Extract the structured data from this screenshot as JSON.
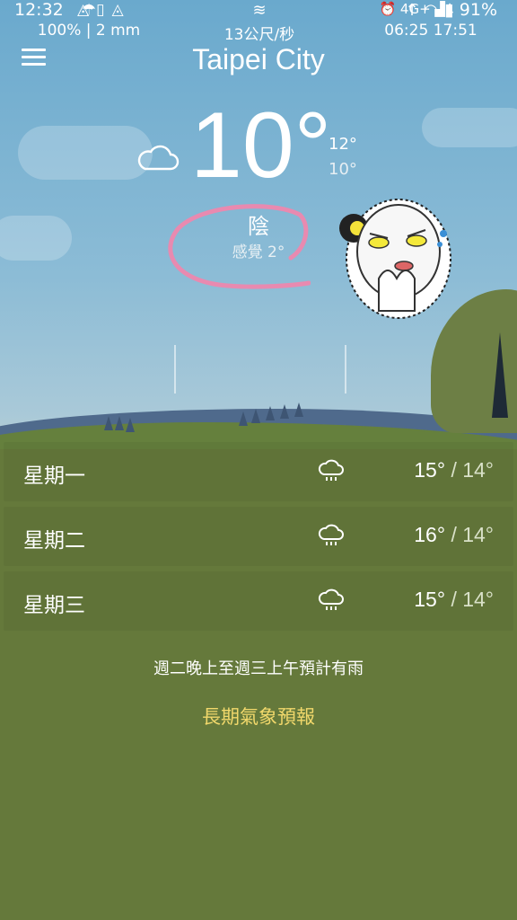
{
  "status_bar": {
    "time": "12:32",
    "network": "4G+",
    "battery": "91%",
    "icons_left": [
      "app-notification-icon",
      "clipboard-icon",
      "app-notification-icon"
    ],
    "icons_right": [
      "alarm-icon",
      "signal-icon",
      "battery-icon"
    ]
  },
  "header": {
    "city": "Taipei City",
    "menu_icon": "hamburger-menu-icon"
  },
  "current": {
    "temperature": "10°",
    "high": "12°",
    "low": "10°",
    "condition": "陰",
    "feels_like": "感覺 2°",
    "icon": "cloud-icon"
  },
  "stats": {
    "precipitation": "100% | 2 mm",
    "wind": "13公尺/秒",
    "sunrise": "06:25",
    "sunset": "17:51",
    "precip_icon": "umbrella-icon",
    "wind_icon": "wind-icon",
    "sun_icon": "sunrise-sunset-icon"
  },
  "forecast": [
    {
      "day": "星期一",
      "high": "15°",
      "low": "14°",
      "icon": "rain-cloud-icon"
    },
    {
      "day": "星期二",
      "high": "16°",
      "low": "14°",
      "icon": "rain-cloud-icon"
    },
    {
      "day": "星期三",
      "high": "15°",
      "low": "14°",
      "icon": "rain-cloud-icon"
    }
  ],
  "temp_separator": "/",
  "note": "週二晚上至週三上午預計有雨",
  "long_range_link": "長期氣象預報",
  "colors": {
    "sky_top": "#6aa9cd",
    "ground": "#65793b",
    "link": "#f1d86b",
    "annotation_circle": "#e88ab0"
  }
}
